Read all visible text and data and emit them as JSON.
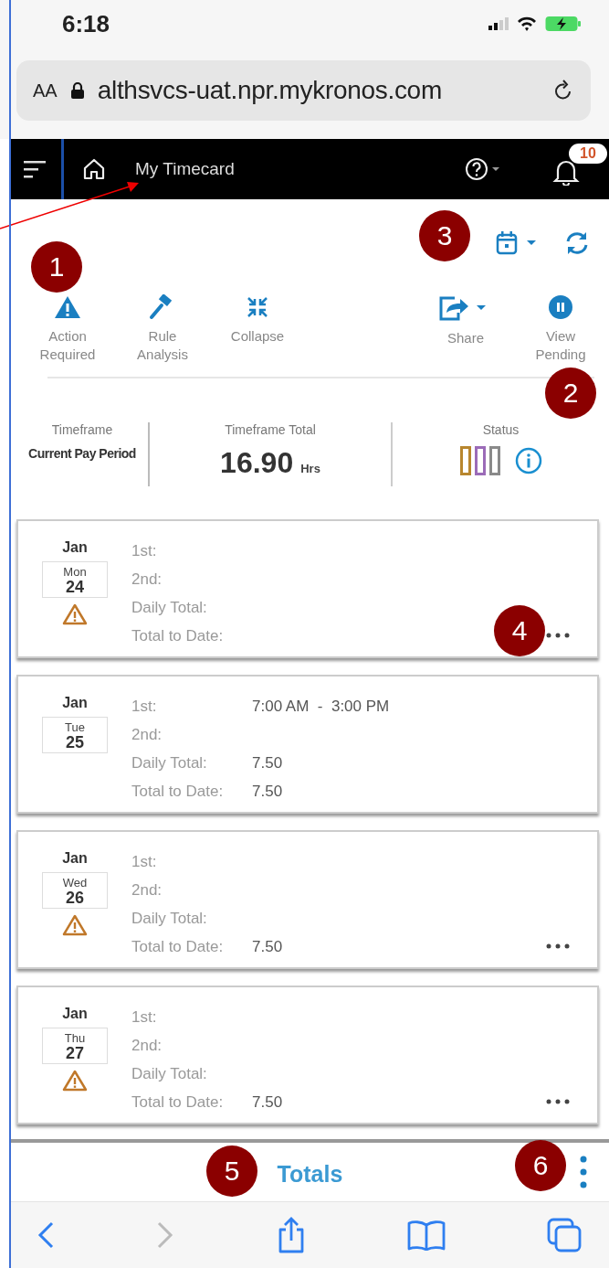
{
  "status_bar": {
    "time": "6:18"
  },
  "browser": {
    "text_size_button": "AA",
    "url": "althsvcs-uat.npr.mykronos.com"
  },
  "nav": {
    "title": "My Timecard",
    "notification_count": "10"
  },
  "actions": [
    {
      "label": "Action Required",
      "kind": "warning"
    },
    {
      "label": "Rule Analysis",
      "kind": "gavel"
    },
    {
      "label": "Collapse",
      "kind": "collapse"
    },
    {
      "label": "Share",
      "kind": "share"
    },
    {
      "label": "View Pending",
      "kind": "pending"
    }
  ],
  "summary": {
    "timeframe_label": "Timeframe",
    "timeframe": "Current Pay Period",
    "total_label": "Timeframe Total",
    "total": "16.90",
    "unit": "Hrs",
    "status_label": "Status",
    "status_marks": [
      {
        "color": "#b8862e"
      },
      {
        "color": "#9b6bb8"
      },
      {
        "color": "#8a8a8a"
      }
    ]
  },
  "days": [
    {
      "month": "Jan",
      "weekday": "Mon",
      "day": "24",
      "warning": true,
      "menu": true,
      "rows": [
        {
          "label": "1st:"
        },
        {
          "label": "2nd:"
        },
        {
          "label": "Daily Total:"
        },
        {
          "label": "Total to Date:"
        }
      ]
    },
    {
      "month": "Jan",
      "weekday": "Tue",
      "day": "25",
      "warning": false,
      "menu": false,
      "rows": [
        {
          "label": "1st:",
          "value": "7:00 AM  -  3:00 PM"
        },
        {
          "label": "2nd:"
        },
        {
          "label": "Daily Total:",
          "value": "7.50"
        },
        {
          "label": "Total to Date:",
          "value": "7.50"
        }
      ]
    },
    {
      "month": "Jan",
      "weekday": "Wed",
      "day": "26",
      "warning": true,
      "menu": true,
      "rows": [
        {
          "label": "1st:"
        },
        {
          "label": "2nd:"
        },
        {
          "label": "Daily Total:"
        },
        {
          "label": "Total to Date:",
          "value": "7.50"
        }
      ]
    },
    {
      "month": "Jan",
      "weekday": "Thu",
      "day": "27",
      "warning": true,
      "menu": true,
      "rows": [
        {
          "label": "1st:"
        },
        {
          "label": "2nd:"
        },
        {
          "label": "Daily Total:"
        },
        {
          "label": "Total to Date:",
          "value": "7.50"
        }
      ]
    }
  ],
  "footer": {
    "totals": "Totals"
  },
  "callouts": [
    "1",
    "2",
    "3",
    "4",
    "5",
    "6"
  ]
}
